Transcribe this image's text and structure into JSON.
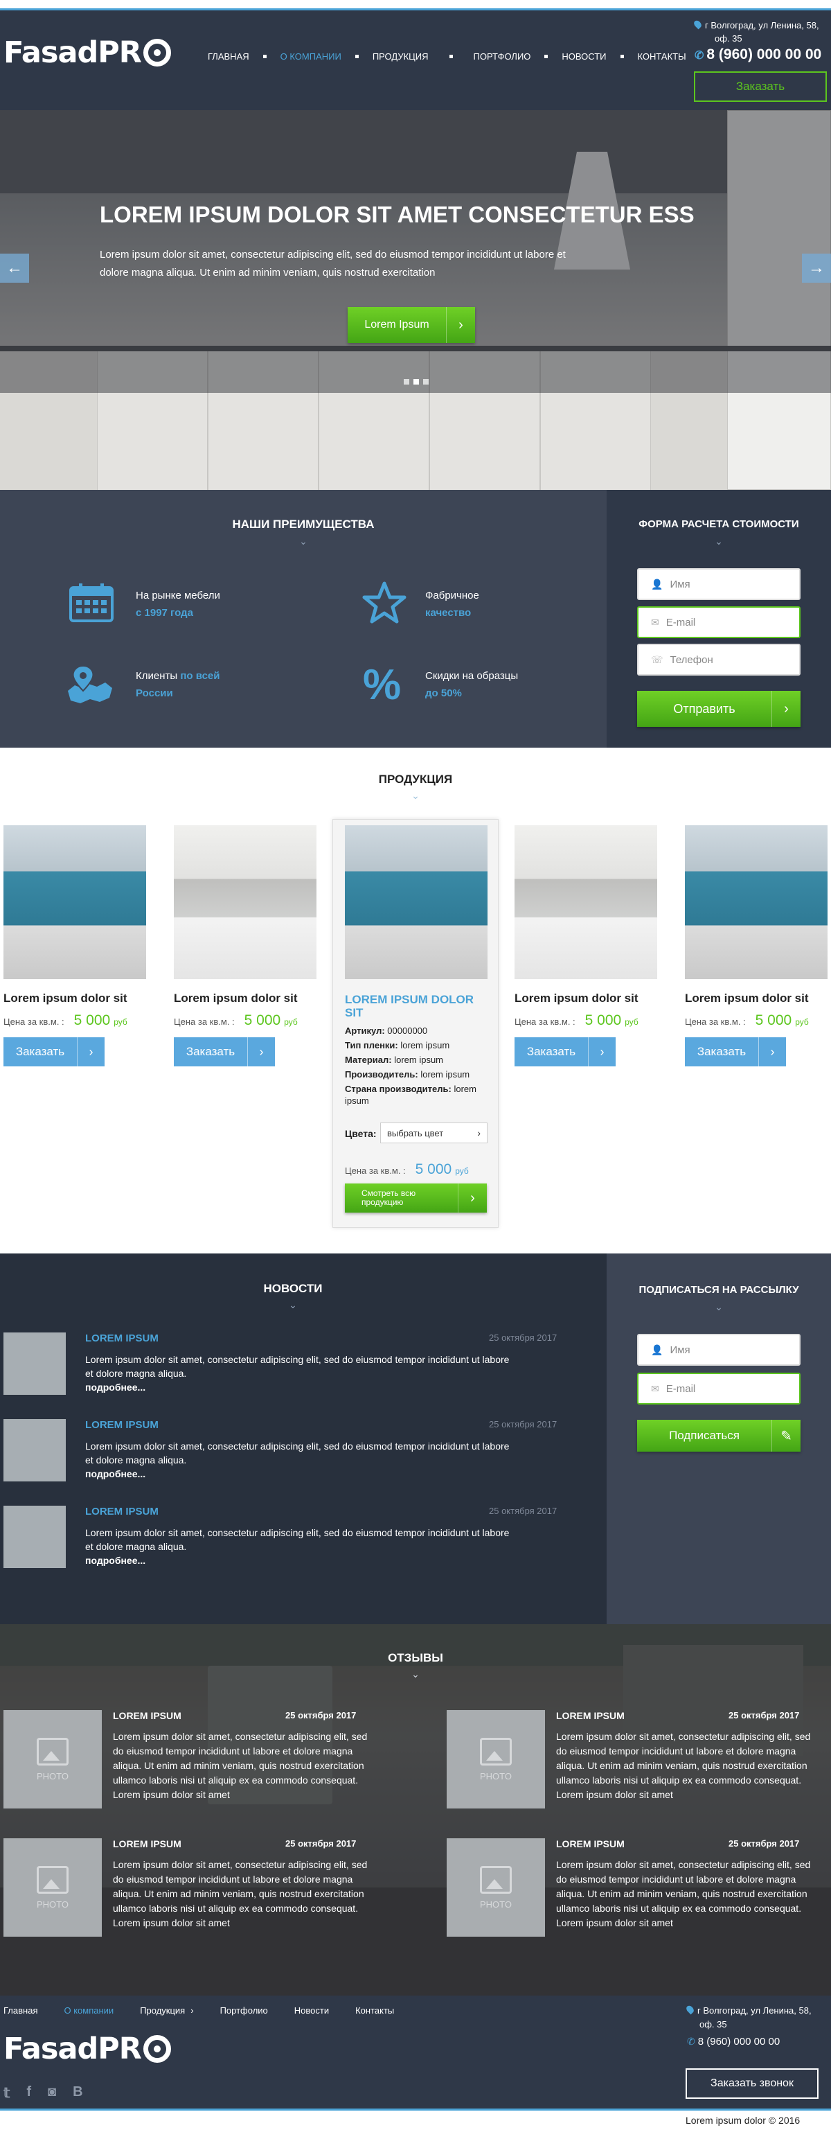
{
  "header": {
    "logo": "FasadPR",
    "nav": [
      {
        "label": "Главная",
        "active": false
      },
      {
        "label": "О компании",
        "active": true
      },
      {
        "label": "Продукция",
        "active": false
      },
      {
        "label": "Портфолио",
        "active": false
      },
      {
        "label": "Новости",
        "active": false
      },
      {
        "label": "Контакты",
        "active": false
      }
    ],
    "address_line1": "г Волгоград, ул Ленина, 58,",
    "address_line2": "оф. 35",
    "phone": "8 (960) 000 00 00",
    "order_button": "Заказать"
  },
  "hero": {
    "title": "LOREM IPSUM DOLOR SIT AMET CONSECTETUR ESS",
    "text_line1": "Lorem ipsum dolor sit amet, consectetur adipiscing elit, sed do eiusmod tempor incididunt ut labore et",
    "text_line2": "dolore magna aliqua. Ut enim ad minim veniam, quis nostrud exercitation",
    "button": "Lorem Ipsum",
    "prev_icon": "arrow-left-icon",
    "next_icon": "arrow-right-icon",
    "slides_count": 3
  },
  "advantages": {
    "title": "НАШИ ПРЕИМУЩЕСТВА",
    "items": [
      {
        "icon": "calendar-icon",
        "line1": "На рынке мебели",
        "line2": "с 1997 года"
      },
      {
        "icon": "star-icon",
        "line1": "Фабричное",
        "line2": "качество"
      },
      {
        "icon": "map-pin-russia-icon",
        "line1a": "Клиенты ",
        "line1b": "по всей",
        "line2": "России"
      },
      {
        "icon": "percent-icon",
        "line1": "Скидки на образцы",
        "line2": "до 50%"
      }
    ]
  },
  "calc_form": {
    "title": "ФОРМА РАСЧЕТА СТОИМОСТИ",
    "name_placeholder": "Имя",
    "email_placeholder": "E-mail",
    "phone_placeholder": "Телефон",
    "submit": "Отправить"
  },
  "products": {
    "title": "ПРОДУКЦИЯ",
    "price_label": "Цена за кв.м. :",
    "currency": "руб",
    "order_label": "Заказать",
    "items": [
      {
        "name": "Lorem ipsum dolor sit",
        "price": "5 000"
      },
      {
        "name": "Lorem ipsum dolor sit",
        "price": "5 000"
      },
      {
        "name": "Lorem ipsum dolor sit",
        "price": "5 000"
      },
      {
        "name": "Lorem ipsum dolor sit",
        "price": "5 000"
      }
    ],
    "featured": {
      "name_line1": "LOREM IPSUM DOLOR",
      "name_line2": "SIT",
      "article_label": "Артикул:",
      "article": "00000000",
      "film_label": "Тип пленки:",
      "film": "lorem ipsum",
      "material_label": "Материал:",
      "material": "lorem ipsum",
      "maker_label": "Производитель:",
      "maker": "lorem ipsum",
      "country_label": "Страна производитель:",
      "country_a": "lorem",
      "country_b": "ipsum",
      "colors_label": "Цвета:",
      "color_select": "выбрать цвет",
      "price_label": "Цена за кв.м. :",
      "price": "5 000",
      "currency": "руб",
      "view_all_line1": "Смотреть всю",
      "view_all_line2": "продукцию"
    }
  },
  "news": {
    "title": "НОВОСТИ",
    "items": [
      {
        "title": "LOREM IPSUM",
        "date": "25 октября 2017",
        "text1": "Lorem ipsum dolor sit amet, consectetur adipiscing elit, sed do eiusmod tempor incididunt ut labore",
        "text2": "et dolore magna aliqua.",
        "more": "подробнее..."
      },
      {
        "title": "LOREM IPSUM",
        "date": "25 октября 2017",
        "text1": "Lorem ipsum dolor sit amet, consectetur adipiscing elit, sed do eiusmod tempor incididunt ut labore",
        "text2": "et dolore magna aliqua.",
        "more": "подробнее..."
      },
      {
        "title": "LOREM IPSUM",
        "date": "25 октября 2017",
        "text1": "Lorem ipsum dolor sit amet, consectetur adipiscing elit, sed do eiusmod tempor incididunt ut labore",
        "text2": "et dolore magna aliqua.",
        "more": "подробнее..."
      }
    ]
  },
  "subscribe": {
    "title": "ПОДПИСАТЬСЯ НА РАССЫЛКУ",
    "name_placeholder": "Имя",
    "email_placeholder": "E-mail",
    "button": "Подписаться"
  },
  "reviews": {
    "title": "ОТЗЫВЫ",
    "photo_label": "PHOTO",
    "items": [
      {
        "name": "LOREM IPSUM",
        "date": "25 октября 2017",
        "lines": [
          "Lorem ipsum dolor sit amet, consectetur adipiscing elit, sed",
          "do eiusmod tempor incididunt ut labore et dolore magna",
          "aliqua. Ut enim ad minim veniam, quis nostrud exercitation",
          "ullamco laboris nisi ut aliquip ex ea commodo consequat.",
          "Lorem ipsum dolor sit amet"
        ]
      },
      {
        "name": "LOREM IPSUM",
        "date": "25 октября 2017",
        "lines": [
          "Lorem ipsum dolor sit amet, consectetur adipiscing elit, sed",
          "do eiusmod tempor incididunt ut labore et dolore magna",
          "aliqua. Ut enim ad minim veniam, quis nostrud exercitation",
          "ullamco laboris nisi ut aliquip ex ea commodo consequat.",
          "Lorem ipsum dolor sit amet"
        ]
      },
      {
        "name": "LOREM IPSUM",
        "date": "25 октября 2017",
        "lines": [
          "Lorem ipsum dolor sit amet, consectetur adipiscing elit, sed",
          "do eiusmod tempor incididunt ut labore et dolore magna",
          "aliqua. Ut enim ad minim veniam, quis nostrud exercitation",
          "ullamco laboris nisi ut aliquip ex ea commodo consequat.",
          "Lorem ipsum dolor sit amet"
        ]
      },
      {
        "name": "LOREM IPSUM",
        "date": "25 октября 2017",
        "lines": [
          "Lorem ipsum dolor sit amet, consectetur adipiscing elit, sed",
          "do eiusmod tempor incididunt ut labore et dolore magna",
          "aliqua. Ut enim ad minim veniam, quis nostrud exercitation",
          "ullamco laboris nisi ut aliquip ex ea commodo consequat.",
          "Lorem ipsum dolor sit amet"
        ]
      }
    ]
  },
  "footer": {
    "nav": [
      {
        "label": "Главная",
        "active": false
      },
      {
        "label": "О компании",
        "active": true
      },
      {
        "label": "Продукция",
        "active": false
      },
      {
        "label": "Портфолио",
        "active": false
      },
      {
        "label": "Новости",
        "active": false
      },
      {
        "label": "Контакты",
        "active": false
      }
    ],
    "logo": "FasadPR",
    "address_line1": "г Волгоград, ул Ленина, 58,",
    "address_line2": "оф. 35",
    "phone": "8 (960) 000 00 00",
    "callback_button": "Заказать звонок",
    "social": [
      "twitter-icon",
      "facebook-icon",
      "instagram-icon",
      "vk-icon"
    ],
    "copyright": "Lorem ipsum dolor © 2016"
  },
  "colors": {
    "accent_blue": "#4aa3d7",
    "accent_green": "#5cc61e",
    "dark": "#2f3848"
  }
}
